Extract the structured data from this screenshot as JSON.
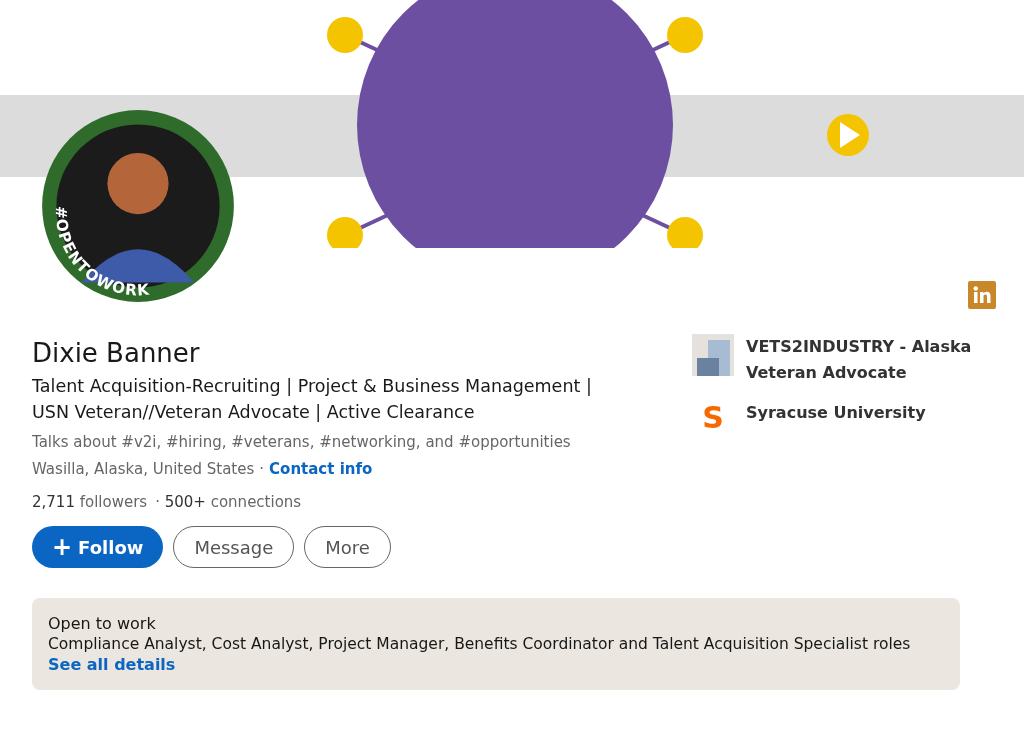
{
  "avatar": {
    "frame_label": "#OPENTOWORK"
  },
  "profile": {
    "name": "Dixie Banner",
    "headline": "Talent Acquisition-Recruiting | Project & Business Management | USN Veteran//Veteran Advocate | Active Clearance",
    "talks_about": "Talks about #v2i, #hiring, #veterans, #networking, and #opportunities",
    "location": "Wasilla, Alaska, United States",
    "separator": "·",
    "contact_link": "Contact info",
    "followers": "**2,711** followers",
    "connections": "· **500+** connections"
  },
  "buttons": [
    {
      "label": "Follow",
      "icon": "+",
      "kind": "primary"
    },
    {
      "label": "Message",
      "kind": "outline"
    },
    {
      "label": "More",
      "kind": "outline"
    }
  ],
  "affiliations": [
    {
      "name": "VETS2INDUSTRY - Alaska Veteran Advocate",
      "kind": "company"
    },
    {
      "name": "Syracuse University",
      "kind": "school",
      "logo_letter": "S"
    }
  ],
  "open_to_work": {
    "title": "Open to work",
    "roles": "Compliance Analyst, Cost Analyst, Project Manager, Benefits Coordinator and Talent Acquisition Specialist roles",
    "link": "See all details"
  }
}
